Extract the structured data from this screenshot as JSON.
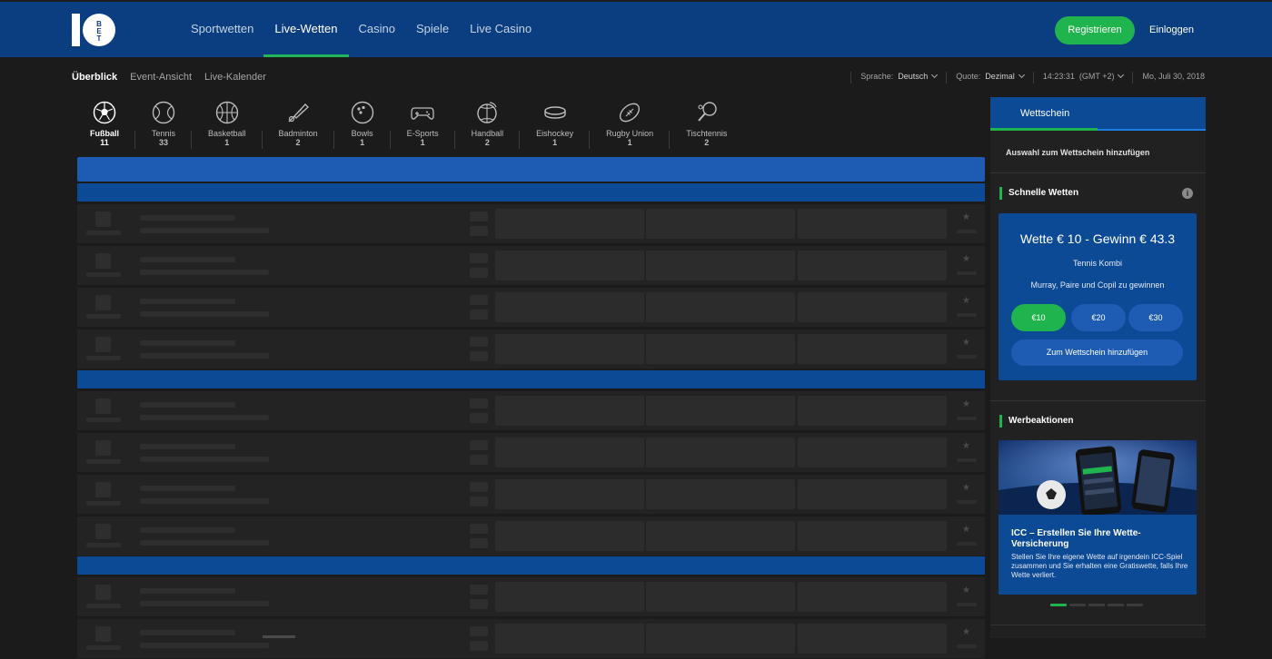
{
  "header": {
    "logo_text": "10 BET",
    "nav": [
      {
        "label": "Sportwetten",
        "active": false
      },
      {
        "label": "Live-Wetten",
        "active": true
      },
      {
        "label": "Casino",
        "active": false
      },
      {
        "label": "Spiele",
        "active": false
      },
      {
        "label": "Live Casino",
        "active": false
      }
    ],
    "register_label": "Registrieren",
    "login_label": "Einloggen",
    "colors": {
      "brand": "#0b3e80",
      "accent": "#20b44e"
    }
  },
  "subbar": {
    "tabs": [
      {
        "label": "Überblick",
        "active": true
      },
      {
        "label": "Event-Ansicht",
        "active": false
      },
      {
        "label": "Live-Kalender",
        "active": false
      }
    ],
    "language_label": "Sprache:",
    "language_value": "Deutsch",
    "odds_label": "Quote:",
    "odds_value": "Dezimal",
    "time": "14:23:31",
    "timezone": "(GMT +2)",
    "date": "Mo, Juli 30, 2018"
  },
  "sports": [
    {
      "name": "Fußball",
      "count": "11",
      "icon": "football-icon",
      "active": true
    },
    {
      "name": "Tennis",
      "count": "33",
      "icon": "tennis-icon",
      "active": false
    },
    {
      "name": "Basketball",
      "count": "1",
      "icon": "basketball-icon",
      "active": false
    },
    {
      "name": "Badminton",
      "count": "2",
      "icon": "badminton-icon",
      "active": false
    },
    {
      "name": "Bowls",
      "count": "1",
      "icon": "bowls-icon",
      "active": false
    },
    {
      "name": "E-Sports",
      "count": "1",
      "icon": "gamepad-icon",
      "active": false
    },
    {
      "name": "Handball",
      "count": "2",
      "icon": "handball-icon",
      "active": false
    },
    {
      "name": "Eishockey",
      "count": "1",
      "icon": "puck-icon",
      "active": false
    },
    {
      "name": "Rugby Union",
      "count": "1",
      "icon": "rugby-icon",
      "active": false
    },
    {
      "name": "Tischtennis",
      "count": "2",
      "icon": "table-tennis-icon",
      "active": false
    }
  ],
  "betslip": {
    "tab_label": "Wettschein",
    "hint": "Auswahl zum Wettschein hinzufügen",
    "quick_title": "Schnelle Wetten",
    "quick": {
      "headline": "Wette € 10 - Gewinn € 43.3",
      "type": "Tennis Kombi",
      "description": "Murray, Paire und Copil zu gewinnen",
      "amounts": [
        "€10",
        "€20",
        "€30"
      ],
      "selected_amount": "€10",
      "add_label": "Zum Wettschein hinzufügen"
    },
    "promo_title": "Werbeaktionen",
    "promo": {
      "headline": "ICC – Erstellen Sie Ihre Wette-Versicherung",
      "text": "Stellen Sie Ihre eigene Wette auf irgendein ICC-Spiel zusammen und Sie erhalten eine Gratiswette, falls Ihre Wette verliert.",
      "slides": 5,
      "active_slide": 1
    }
  }
}
